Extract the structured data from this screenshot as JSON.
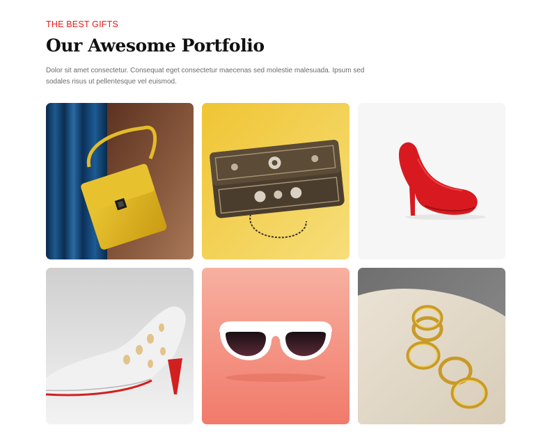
{
  "section": {
    "eyebrow": "THE BEST GIFTS",
    "title": "Our Awesome Portfolio",
    "description": "Dolor sit amet consectetur. Consequat eget consectetur maecenas sed molestie malesuada. Ipsum sed sodales risus ut pellentesque vel euismod."
  },
  "colors": {
    "accent": "#e21b1b",
    "title": "#111111",
    "body_text": "#6b6b6b"
  },
  "portfolio": {
    "items": [
      {
        "icon": "yellow-handbag-image"
      },
      {
        "icon": "ornate-metal-clutch-image"
      },
      {
        "icon": "red-high-heel-image"
      },
      {
        "icon": "white-pump-shoe-image"
      },
      {
        "icon": "white-sunglasses-image"
      },
      {
        "icon": "gold-rings-image"
      }
    ]
  }
}
